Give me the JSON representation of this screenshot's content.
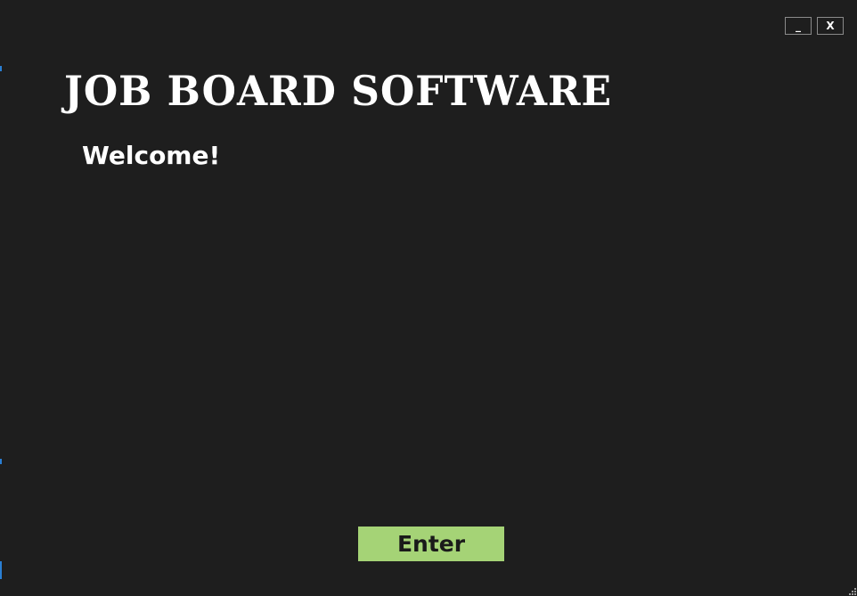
{
  "window": {
    "title": "JOB BOARD SOFTWARE",
    "minimize_label": "_",
    "close_label": "X",
    "icons": [
      "minimize-icon",
      "close-icon",
      "resize-grip-icon"
    ]
  },
  "main": {
    "welcome_text": "Welcome!",
    "enter_label": "Enter"
  },
  "colors": {
    "background": "#1e1e1e",
    "text": "#ffffff",
    "enter_button": "#a5d376",
    "enter_text": "#1a1a1a",
    "edge_accent": "#2a7fd4"
  }
}
